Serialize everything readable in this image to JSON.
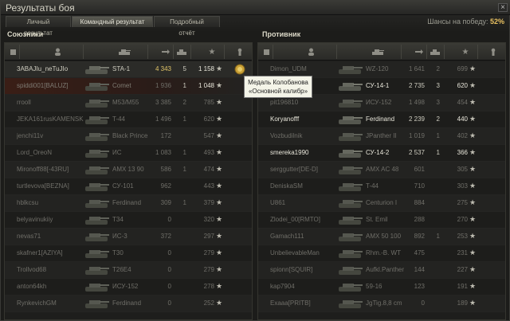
{
  "window": {
    "title": "Результаты боя",
    "close_label": "×"
  },
  "tabs": [
    {
      "label": "Личный результат"
    },
    {
      "label": "Командный результат"
    },
    {
      "label": "Подробный отчёт"
    }
  ],
  "chances": {
    "label": "Шансы на победу:",
    "value": "52%"
  },
  "allies": {
    "title": "Союзники",
    "rows": [
      {
        "name": "3ABAJIu_neTuJIo",
        "tank": "STA-1",
        "damage": "4 343",
        "kills": "5",
        "xp": "1 158",
        "state": "self"
      },
      {
        "name": "spiddi001[BALUZ]",
        "tank": "Comet",
        "damage": "1 936",
        "kills": "1",
        "xp": "1 048",
        "state": "dead-red"
      },
      {
        "name": "rrooll",
        "tank": "M53/M55",
        "damage": "3 385",
        "kills": "2",
        "xp": "785",
        "state": "dead"
      },
      {
        "name": "JEKA161rusKAMENSK",
        "tank": "T-44",
        "damage": "1 496",
        "kills": "1",
        "xp": "620",
        "state": "dead"
      },
      {
        "name": "jenchi11v",
        "tank": "Black Prince",
        "damage": "172",
        "kills": "",
        "xp": "547",
        "state": "dead"
      },
      {
        "name": "Lord_OreoN",
        "tank": "ИС",
        "damage": "1 083",
        "kills": "1",
        "xp": "493",
        "state": "dead"
      },
      {
        "name": "Mironoff88[-43RU]",
        "tank": "AMX 13 90",
        "damage": "586",
        "kills": "1",
        "xp": "474",
        "state": "dead"
      },
      {
        "name": "turtlevova[BEZNA]",
        "tank": "СУ-101",
        "damage": "962",
        "kills": "",
        "xp": "443",
        "state": "dead"
      },
      {
        "name": "hblkcsu",
        "tank": "Ferdinand",
        "damage": "309",
        "kills": "1",
        "xp": "379",
        "state": "dead"
      },
      {
        "name": "belyavinukiiy",
        "tank": "T34",
        "damage": "0",
        "kills": "",
        "xp": "320",
        "state": "dead"
      },
      {
        "name": "nevas71",
        "tank": "ИС-3",
        "damage": "372",
        "kills": "",
        "xp": "297",
        "state": "dead"
      },
      {
        "name": "skafner1[AZIYA]",
        "tank": "T30",
        "damage": "0",
        "kills": "",
        "xp": "279",
        "state": "dead"
      },
      {
        "name": "Trollvod68",
        "tank": "T26E4",
        "damage": "0",
        "kills": "",
        "xp": "279",
        "state": "dead"
      },
      {
        "name": "anton64kh",
        "tank": "ИСУ-152",
        "damage": "0",
        "kills": "",
        "xp": "278",
        "state": "dead"
      },
      {
        "name": "RynkevichGM",
        "tank": "Ferdinand",
        "damage": "0",
        "kills": "",
        "xp": "252",
        "state": "dead"
      }
    ]
  },
  "enemies": {
    "title": "Противник",
    "rows": [
      {
        "name": "Dimon_UDM",
        "tank": "WZ-120",
        "damage": "1 641",
        "kills": "2",
        "xp": "699",
        "state": "dead"
      },
      {
        "name": "",
        "tank": "СУ-14-1",
        "damage": "2 735",
        "kills": "3",
        "xp": "620",
        "state": "alive"
      },
      {
        "name": "pit196810",
        "tank": "ИСУ-152",
        "damage": "1 498",
        "kills": "3",
        "xp": "454",
        "state": "dead"
      },
      {
        "name": "Koryanofff",
        "tank": "Ferdinand",
        "damage": "2 239",
        "kills": "2",
        "xp": "440",
        "state": "alive"
      },
      {
        "name": "Vozbudilnik",
        "tank": "JPanther II",
        "damage": "1 019",
        "kills": "1",
        "xp": "402",
        "state": "dead"
      },
      {
        "name": "smereka1990",
        "tank": "СУ-14-2",
        "damage": "2 537",
        "kills": "1",
        "xp": "366",
        "state": "alive"
      },
      {
        "name": "serggutter[DE-D]",
        "tank": "AMX AC 48",
        "damage": "601",
        "kills": "",
        "xp": "305",
        "state": "dead"
      },
      {
        "name": "DeniskaSM",
        "tank": "T-44",
        "damage": "710",
        "kills": "",
        "xp": "303",
        "state": "dead"
      },
      {
        "name": "U861",
        "tank": "Centurion I",
        "damage": "884",
        "kills": "",
        "xp": "275",
        "state": "dead"
      },
      {
        "name": "Zlodei_00[RMTO]",
        "tank": "St. Emil",
        "damage": "288",
        "kills": "",
        "xp": "270",
        "state": "dead"
      },
      {
        "name": "Gamach111",
        "tank": "AMX 50 100",
        "damage": "892",
        "kills": "1",
        "xp": "253",
        "state": "dead"
      },
      {
        "name": "UnbelievableMan",
        "tank": "Rhm.-B. WT",
        "damage": "475",
        "kills": "",
        "xp": "231",
        "state": "dead"
      },
      {
        "name": "spionn[SQUIR]",
        "tank": "Aufkl.Panther",
        "damage": "144",
        "kills": "",
        "xp": "227",
        "state": "dead"
      },
      {
        "name": "kap7904",
        "tank": "59-16",
        "damage": "123",
        "kills": "",
        "xp": "191",
        "state": "dead"
      },
      {
        "name": "Exaaa[PRITB]",
        "tank": "JgTig.8,8 cm",
        "damage": "0",
        "kills": "",
        "xp": "189",
        "state": "dead"
      }
    ]
  },
  "tooltip": {
    "line1": "Медаль Колобанова",
    "line2": "«Основной калибр»"
  },
  "icons": {
    "star": "★",
    "colors": {
      "gold": "#e0c468",
      "accent": "#e8c060"
    }
  }
}
